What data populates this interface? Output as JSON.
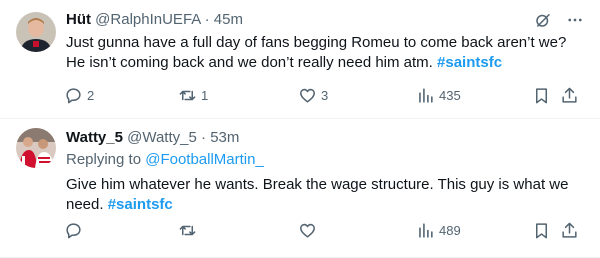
{
  "tweets": [
    {
      "name": "Hüt",
      "handle": "@RalphInUEFA",
      "separator": "·",
      "time": "45m",
      "text": "Just gunna have a full day of fans begging Romeu to come back aren’t we? He isn’t coming back and we don’t really need him atm.",
      "hashtag": "#saintsfc",
      "replies": "2",
      "retweets": "1",
      "likes": "3",
      "views": "435"
    },
    {
      "name": "Watty_5",
      "handle": "@Watty_5",
      "separator": "·",
      "time": "53m",
      "replying_prefix": "Replying to",
      "replying_to": "@FootballMartin_",
      "text": "Give him whatever he wants. Break the wage structure. This guy is what we need.",
      "hashtag": "#saintsfc",
      "views": "489"
    }
  ],
  "colors": {
    "accent": "#1d9bf0",
    "text": "#0f1419",
    "secondary": "#536471",
    "border": "#eff3f4"
  },
  "icons": [
    "grok-icon",
    "more-icon",
    "reply-icon",
    "retweet-icon",
    "like-icon",
    "views-icon",
    "bookmark-icon",
    "share-icon"
  ]
}
